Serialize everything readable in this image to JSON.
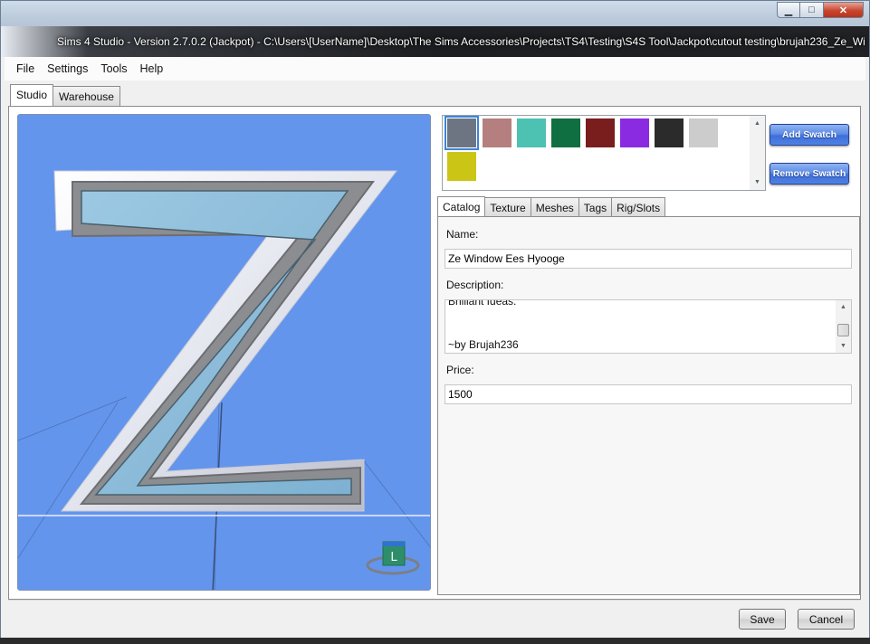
{
  "window": {
    "title": "Sims 4 Studio - Version 2.7.0.2  (Jackpot)   - C:\\Users\\[UserName]\\Desktop\\The Sims Accessories\\Projects\\TS4\\Testing\\S4S Tool\\Jackpot\\cutout testing\\brujah236_Ze_Wi",
    "minimize_glyph": "▁",
    "maximize_glyph": "□",
    "close_glyph": "✕"
  },
  "menu": [
    "File",
    "Settings",
    "Tools",
    "Help"
  ],
  "top_tabs": [
    {
      "label": "Studio",
      "active": true
    },
    {
      "label": "Warehouse",
      "active": false
    }
  ],
  "viewport": {
    "gizmo_label": "L",
    "colors": {
      "background": "#6495ed",
      "glass": "#87b7d6",
      "frame": "#7d7f82",
      "gizmo": "#2d8f6a"
    }
  },
  "swatches": [
    {
      "color": "#6e7582",
      "selected": true
    },
    {
      "color": "#b57f7f",
      "selected": false
    },
    {
      "color": "#4dc1b2",
      "selected": false
    },
    {
      "color": "#0f6f40",
      "selected": false
    },
    {
      "color": "#7a1d1d",
      "selected": false
    },
    {
      "color": "#8a2be2",
      "selected": false
    },
    {
      "color": "#2b2b2b",
      "selected": false
    },
    {
      "color": "#cccccc",
      "selected": false
    },
    {
      "color": "#cbc616",
      "selected": false
    }
  ],
  "swatch_actions": {
    "add": "Add Swatch",
    "remove": "Remove Swatch"
  },
  "sub_tabs": [
    {
      "label": "Catalog",
      "active": true
    },
    {
      "label": "Texture",
      "active": false
    },
    {
      "label": "Meshes",
      "active": false
    },
    {
      "label": "Tags",
      "active": false
    },
    {
      "label": "Rig/Slots",
      "active": false
    }
  ],
  "catalog": {
    "name_label": "Name:",
    "name_value": "Ze Window Ees Hyooge",
    "description_label": "Description:",
    "description_lines": [
      "Brilliant Ideas.",
      "",
      "~by Brujah236"
    ],
    "price_label": "Price:",
    "price_value": "1500"
  },
  "footer": {
    "save": "Save",
    "cancel": "Cancel"
  }
}
